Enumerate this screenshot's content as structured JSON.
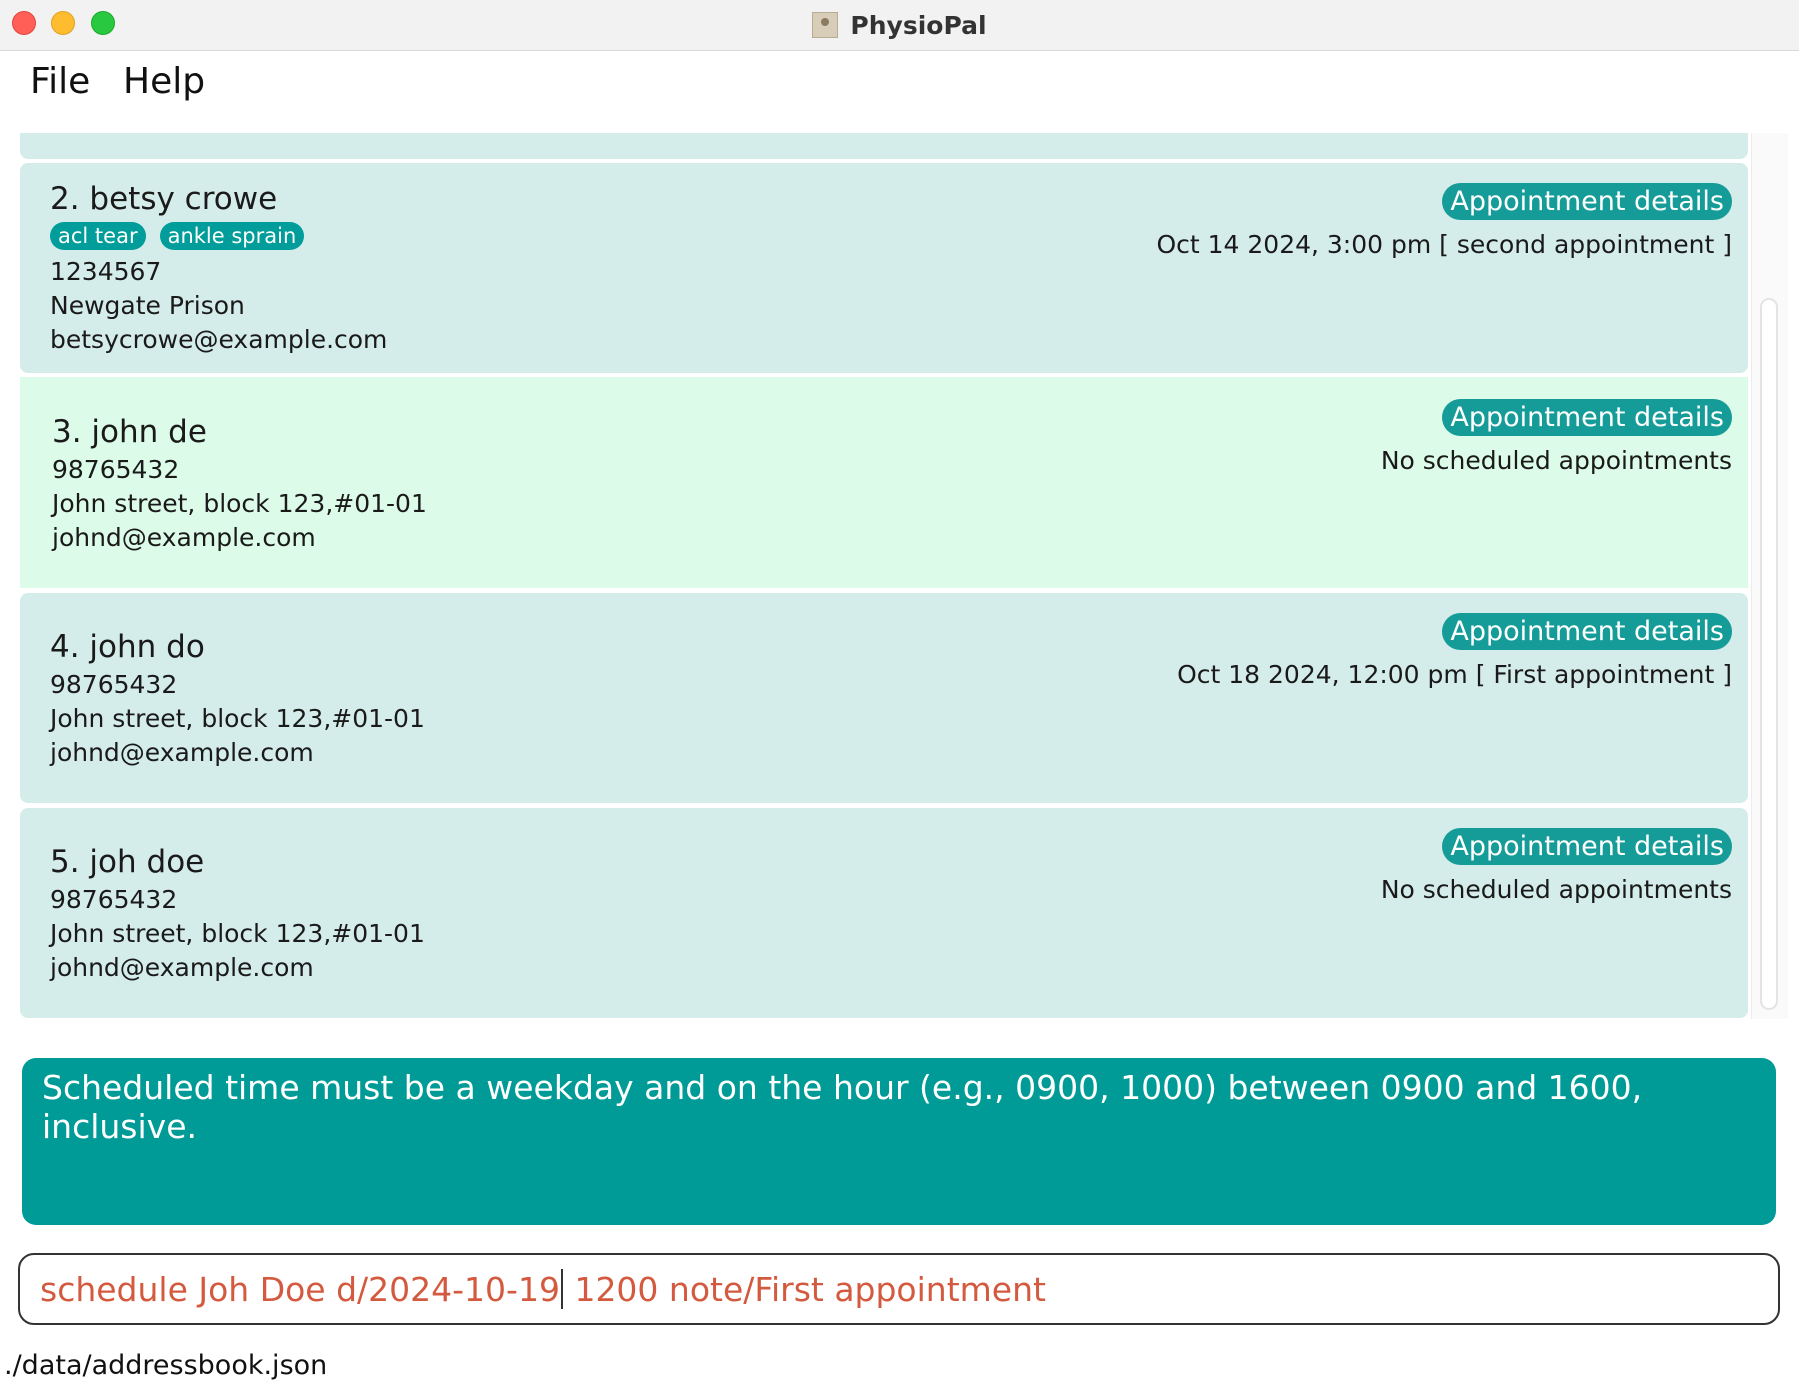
{
  "window": {
    "title": "PhysioPal"
  },
  "menu": {
    "file": "File",
    "help": "Help"
  },
  "patients": [
    {
      "index_name": "2. betsy crowe",
      "tags": [
        "acl tear",
        "ankle sprain"
      ],
      "phone": "1234567",
      "address": "Newgate Prison",
      "email": "betsycrowe@example.com",
      "appointment_button": "Appointment details",
      "appointment": "Oct 14 2024, 3:00 pm [ second appointment ]"
    },
    {
      "index_name": "3. john de",
      "tags": [],
      "phone": "98765432",
      "address": "John street, block 123,#01-01",
      "email": "johnd@example.com",
      "appointment_button": "Appointment details",
      "appointment": "No scheduled appointments",
      "selected": true
    },
    {
      "index_name": "4. john do",
      "tags": [],
      "phone": "98765432",
      "address": "John street, block 123,#01-01",
      "email": "johnd@example.com",
      "appointment_button": "Appointment details",
      "appointment": "Oct 18 2024, 12:00 pm [ First appointment ]"
    },
    {
      "index_name": "5. joh doe",
      "tags": [],
      "phone": "98765432",
      "address": "John street, block 123,#01-01",
      "email": "johnd@example.com",
      "appointment_button": "Appointment details",
      "appointment": "No scheduled appointments"
    }
  ],
  "result_message": "Scheduled time must be a weekday and on the hour (e.g., 0900, 1000) between 0900 and 1600, inclusive.",
  "command": {
    "before_caret": "schedule Joh Doe d/2024-10-19",
    "after_caret": " 1200 note/First appointment"
  },
  "status": {
    "file_path": "./data/addressbook.json"
  },
  "colors": {
    "card": "#d4ecea",
    "card_selected": "#dcfbe9",
    "accent": "#009b97",
    "command_text": "#d35a3f"
  }
}
